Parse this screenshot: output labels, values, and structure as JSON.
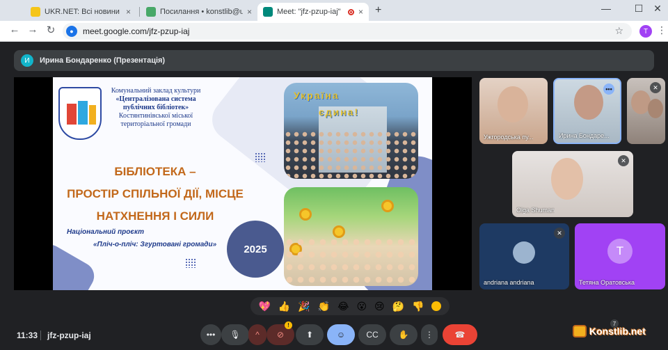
{
  "browser": {
    "tabs": [
      {
        "title": "UKR.NET: Всі новини України,",
        "active": false
      },
      {
        "title": "Посилання • konstlib@ukr.net",
        "active": false
      },
      {
        "title": "Meet: \"jfz-pzup-iaj\"",
        "active": true
      }
    ],
    "url": "meet.google.com/jfz-pzup-iaj",
    "profile_initial": "T"
  },
  "meet": {
    "presenter_banner": {
      "avatar_initial": "И",
      "text": "Ирина Бондаренко (Презентація)"
    },
    "slide": {
      "org_lines": [
        "Комунальний заклад культури",
        "«Централізована система",
        "публічних бібліотек»",
        "Костянтинівської міської",
        "територіальної громади"
      ],
      "headline_lines": [
        "БІБЛІОТЕКА –",
        "ПРОСТІР СПІЛЬНОЇ ДІЇ, МІСЦЕ",
        "НАТХНЕННЯ І СИЛИ"
      ],
      "project_line1": "Національний проєкт",
      "project_line2": "«Пліч-о-пліч: Згуртовані громади»",
      "year": "2025",
      "photo_text1": "Україна",
      "photo_text2": "єдина!"
    },
    "participants": [
      {
        "name": "Ужгородська пу...",
        "muted": false
      },
      {
        "name": "Ирина Бондаре...",
        "muted": false
      },
      {
        "name": "",
        "muted": true
      },
      {
        "name": "Olga Shuman",
        "muted": true
      },
      {
        "name": "andriana andriana",
        "muted": true
      },
      {
        "name": "Тетяна Оратовська",
        "muted": false,
        "initial": "T"
      }
    ],
    "reactions": [
      "💖",
      "👍",
      "🎉",
      "👏",
      "😂",
      "😮",
      "😢",
      "🤔",
      "👎"
    ],
    "footer": {
      "time": "11:33",
      "meeting_code": "jfz-pzup-iaj",
      "people_count": "7",
      "warning_badge": "!"
    },
    "watermark": "Konstlib.net"
  }
}
